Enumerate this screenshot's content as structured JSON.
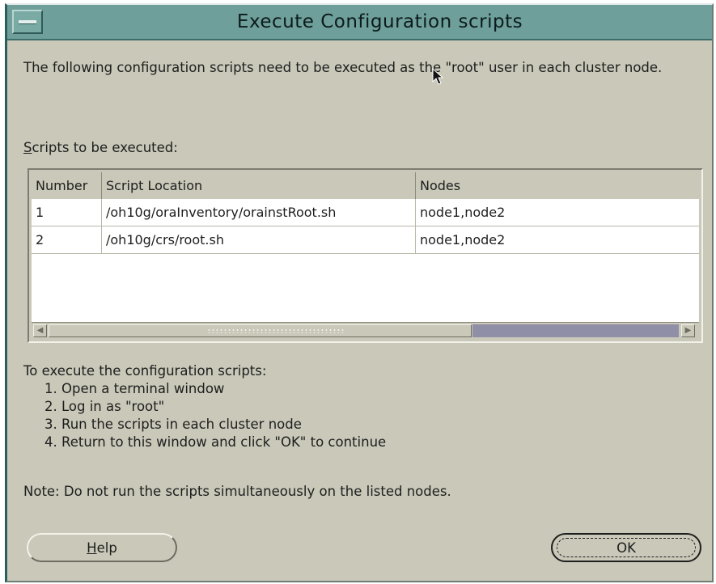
{
  "dialog": {
    "title": "Execute Configuration scripts",
    "intro": "The following configuration scripts need to be executed as the \"root\" user in each cluster node.",
    "scripts_label_first": "S",
    "scripts_label_rest": "cripts to be executed:"
  },
  "table": {
    "columns": [
      "Number",
      "Script Location",
      "Nodes"
    ],
    "rows": [
      {
        "number": "1",
        "location": "/oh10g/oraInventory/orainstRoot.sh",
        "nodes": "node1,node2"
      },
      {
        "number": "2",
        "location": "/oh10g/crs/root.sh",
        "nodes": "node1,node2"
      }
    ],
    "scroll_left_arrow": "◀",
    "scroll_right_arrow": "▶"
  },
  "instructions": {
    "heading": "To execute the configuration scripts:",
    "steps": [
      "1. Open a terminal window",
      "2. Log in as \"root\"",
      "3. Run the scripts in each cluster node",
      "4. Return to this window and click \"OK\" to continue"
    ]
  },
  "note": "Note: Do not run the scripts simultaneously on the listed nodes.",
  "buttons": {
    "help_first": "H",
    "help_rest": "elp",
    "ok": "OK"
  },
  "icons": {
    "window_menu": "window-menu-icon",
    "cursor": "mouse-cursor-icon"
  },
  "colors": {
    "titlebar": "#6f9f9a",
    "background": "#c9c8b9",
    "scroll_track": "#8f8fa8"
  }
}
